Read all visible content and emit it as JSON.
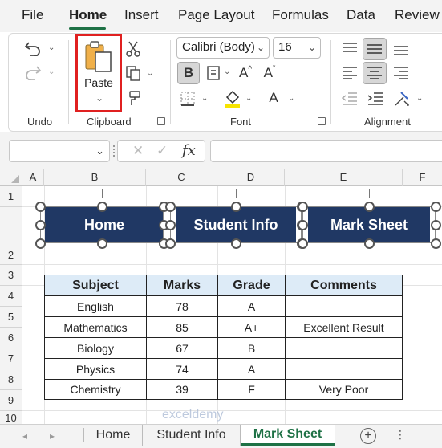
{
  "menu": {
    "tabs": [
      "File",
      "Home",
      "Insert",
      "Page Layout",
      "Formulas",
      "Data",
      "Review"
    ],
    "active_tab": "Home"
  },
  "ribbon": {
    "undo_group_label": "Undo",
    "clipboard_group_label": "Clipboard",
    "paste_label": "Paste",
    "font_group_label": "Font",
    "font_name": "Calibri (Body)",
    "font_size": "16",
    "alignment_group_label": "Alignment",
    "bold_glyph": "B",
    "font_color_glyph": "A",
    "grow_font_glyph": "A",
    "shrink_font_glyph": "A"
  },
  "formula_bar": {
    "name_box_value": "",
    "fx_label": "fx",
    "formula_value": ""
  },
  "grid": {
    "columns": [
      "A",
      "B",
      "C",
      "D",
      "E",
      "F"
    ],
    "rows": [
      "1",
      "2",
      "3",
      "4",
      "5",
      "6",
      "7",
      "8",
      "9",
      "10"
    ]
  },
  "shapes": [
    {
      "label": "Home"
    },
    {
      "label": "Student Info"
    },
    {
      "label": "Mark Sheet"
    }
  ],
  "table": {
    "headers": [
      "Subject",
      "Marks",
      "Grade",
      "Comments"
    ],
    "rows": [
      [
        "English",
        "78",
        "A",
        ""
      ],
      [
        "Mathematics",
        "85",
        "A+",
        "Excellent Result"
      ],
      [
        "Biology",
        "67",
        "B",
        ""
      ],
      [
        "Physics",
        "74",
        "A",
        ""
      ],
      [
        "Chemistry",
        "39",
        "F",
        "Very Poor"
      ]
    ]
  },
  "sheets": {
    "tabs": [
      "Home",
      "Student Info",
      "Mark Sheet"
    ],
    "active": "Mark Sheet",
    "add_glyph": "+",
    "more_glyph": "⋮"
  },
  "watermark": "exceldemy",
  "colors": {
    "shape_fill": "#203864",
    "header_fill": "#ddebf7",
    "accent_green": "#1e7145",
    "highlight_red": "#e02020"
  }
}
